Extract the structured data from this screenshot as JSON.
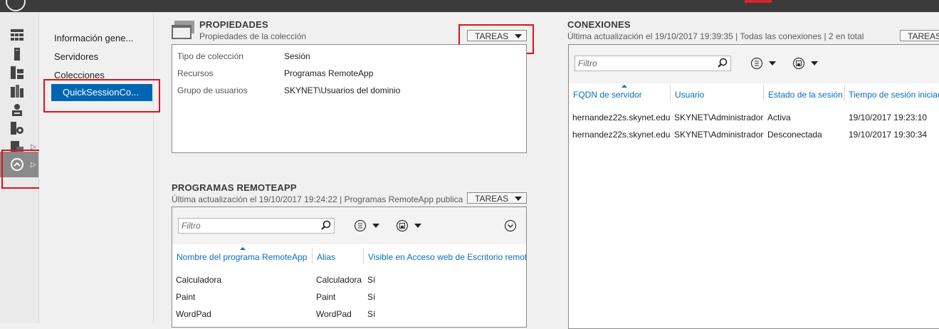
{
  "nav": {
    "items": [
      "Información gene...",
      "Servidores",
      "Colecciones"
    ],
    "selected": "QuickSessionCo..."
  },
  "propiedades": {
    "title": "PROPIEDADES",
    "subtitle": "Propiedades de la colección",
    "tasks_label": "TAREAS",
    "rows": [
      {
        "label": "Tipo de colección",
        "value": "Sesión"
      },
      {
        "label": "Recursos",
        "value": "Programas RemoteApp"
      },
      {
        "label": "Grupo de usuarios",
        "value": "SKYNET\\Usuarios del dominio"
      }
    ]
  },
  "remoteapp": {
    "title": "PROGRAMAS REMOTEAPP",
    "subtitle": "Última actualización el 19/10/2017 19:24:22 | Programas RemoteApp publica...",
    "tasks_label": "TAREAS",
    "filter_placeholder": "Filtro",
    "columns": [
      "Nombre del programa RemoteApp",
      "Alias",
      "Visible en Acceso web de Escritorio remot"
    ],
    "rows": [
      [
        "Calculadora",
        "Calculadora",
        "Sí"
      ],
      [
        "Paint",
        "Paint",
        "Sí"
      ],
      [
        "WordPad",
        "WordPad",
        "Sí"
      ]
    ]
  },
  "conexiones": {
    "title": "CONEXIONES",
    "subtitle": "Última actualización el 19/10/2017 19:39:35 | Todas las conexiones  | 2 en total",
    "tasks_label": "TAREAS",
    "filter_placeholder": "Filtro",
    "columns": [
      "FQDN de servidor",
      "Usuario",
      "Estado de la sesión",
      "Tiempo de sesión iniciad"
    ],
    "rows": [
      [
        "hernandez22s.skynet.edu",
        "SKYNET\\Administrador",
        "Activa",
        "19/10/2017 19:23:10"
      ],
      [
        "hernandez22s.skynet.edu",
        "SKYNET\\Administrador",
        "Desconectada",
        "19/10/2017 19:30:34"
      ]
    ]
  },
  "colors": {
    "highlight": "#e0121b",
    "selected_bg": "#0066b4",
    "link_blue": "#0a6ebd"
  },
  "icons": [
    "dashboard-icon",
    "server-icon",
    "all-servers-icon",
    "roles-icon",
    "user-computer-icon",
    "features-icon",
    "storage-icon",
    "remote-desktop-icon"
  ]
}
